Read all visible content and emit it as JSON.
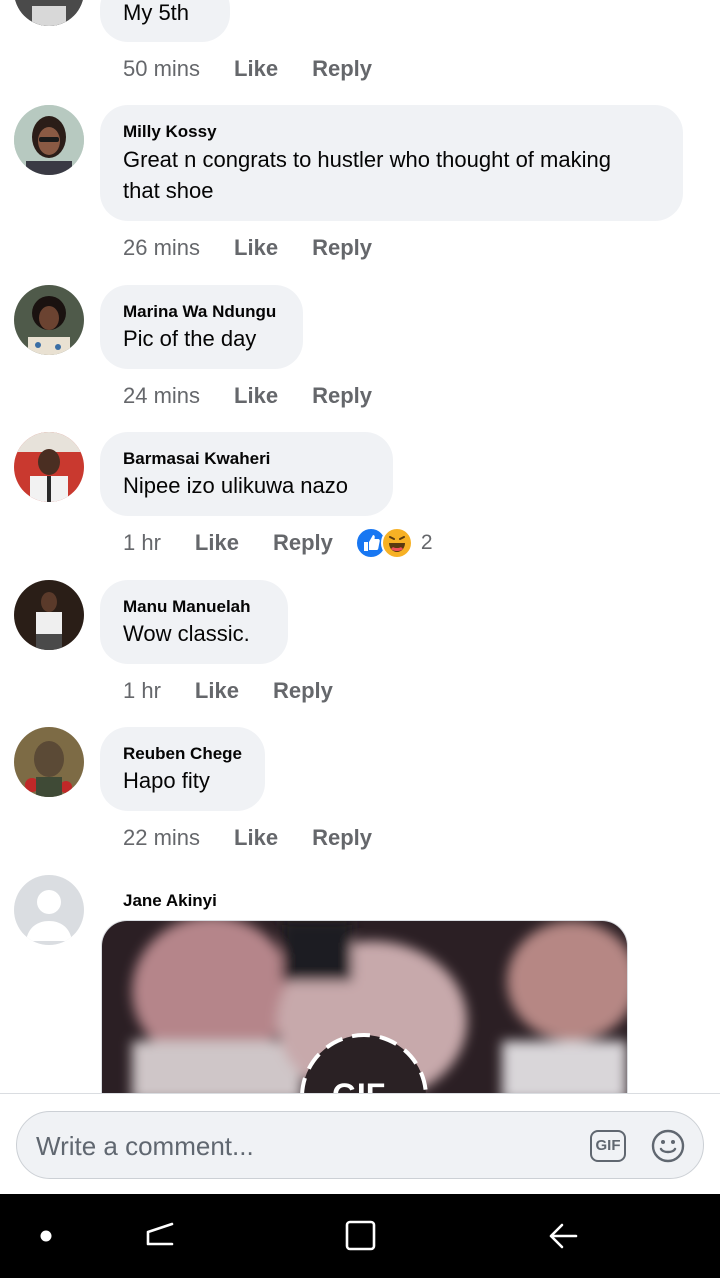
{
  "comments": [
    {
      "author": "",
      "text": "My 5th",
      "time": "50 mins",
      "like": "Like",
      "reply": "Reply"
    },
    {
      "author": "Milly Kossy",
      "text_lines": [
        "Great n congrats to hustler who thought of making",
        "that shoe"
      ],
      "time": "26 mins",
      "like": "Like",
      "reply": "Reply"
    },
    {
      "author": "Marina Wa Ndungu",
      "text": "Pic of the day",
      "time": "24 mins",
      "like": "Like",
      "reply": "Reply"
    },
    {
      "author": "Barmasai Kwaheri",
      "text": "Nipee izo ulikuwa nazo",
      "time": "1 hr",
      "like": "Like",
      "reply": "Reply",
      "reaction_icons": [
        "like-reaction-icon",
        "haha-reaction-icon"
      ],
      "reaction_count": "2"
    },
    {
      "author": "Manu Manuelah",
      "text": "Wow classic.",
      "time": "1 hr",
      "like": "Like",
      "reply": "Reply"
    },
    {
      "author": "Reuben Chege",
      "text": "Hapo fity",
      "time": "22 mins",
      "like": "Like",
      "reply": "Reply"
    },
    {
      "author": "Jane Akinyi",
      "attachment": "gif-image",
      "gif_badge": "GIF"
    }
  ],
  "composer": {
    "placeholder": "Write a comment...",
    "gif_label": "GIF",
    "emoji_icon": "smiley-icon"
  },
  "navbar": {
    "icons": [
      "dot-icon",
      "recents-icon",
      "home-icon",
      "back-icon"
    ]
  },
  "colors": {
    "bubble": "#f0f2f5",
    "meta_text": "#65676b",
    "text": "#050505",
    "like_blue": "#1877f2",
    "haha_yellow": "#f7b125",
    "navbar": "#000000"
  }
}
